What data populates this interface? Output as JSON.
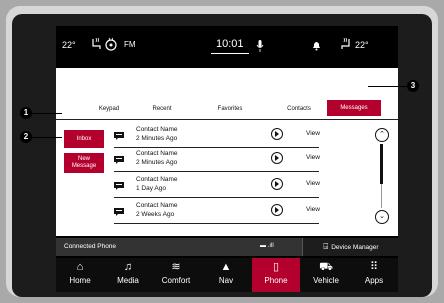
{
  "status": {
    "temp_left": "22°",
    "fm": "FM",
    "clock": "10:01",
    "temp_right": "22°"
  },
  "tabs": [
    "Keypad",
    "Recent",
    "Favorites",
    "Contacts",
    "Messages"
  ],
  "side_buttons": {
    "inbox": "Inbox",
    "new_message_line1": "New",
    "new_message_line2": "Message"
  },
  "messages": [
    {
      "name": "Contact Name",
      "time": "2 Minutes Ago",
      "action": "View"
    },
    {
      "name": "Contact Name",
      "time": "2 Minutes Ago",
      "action": "View"
    },
    {
      "name": "Contact Name",
      "time": "1 Day Ago",
      "action": "View"
    },
    {
      "name": "Contact Name",
      "time": "2 Weeks Ago",
      "action": "View"
    }
  ],
  "connected_phone": "Connected Phone",
  "device_manager": "Device Manager",
  "nav": [
    "Home",
    "Media",
    "Comfort",
    "Nav",
    "Phone",
    "Vehicle",
    "Apps"
  ],
  "callouts": [
    "1",
    "2",
    "3"
  ],
  "colors": {
    "accent": "#b3002d"
  },
  "icons": {
    "seat_heat": "heated-seat-icon",
    "steering_heat": "heated-steering-wheel-icon",
    "mic": "microphone-icon",
    "bell": "notification-bell-icon",
    "message": "message-icon",
    "play": "play-icon",
    "device": "device-manager-icon"
  }
}
